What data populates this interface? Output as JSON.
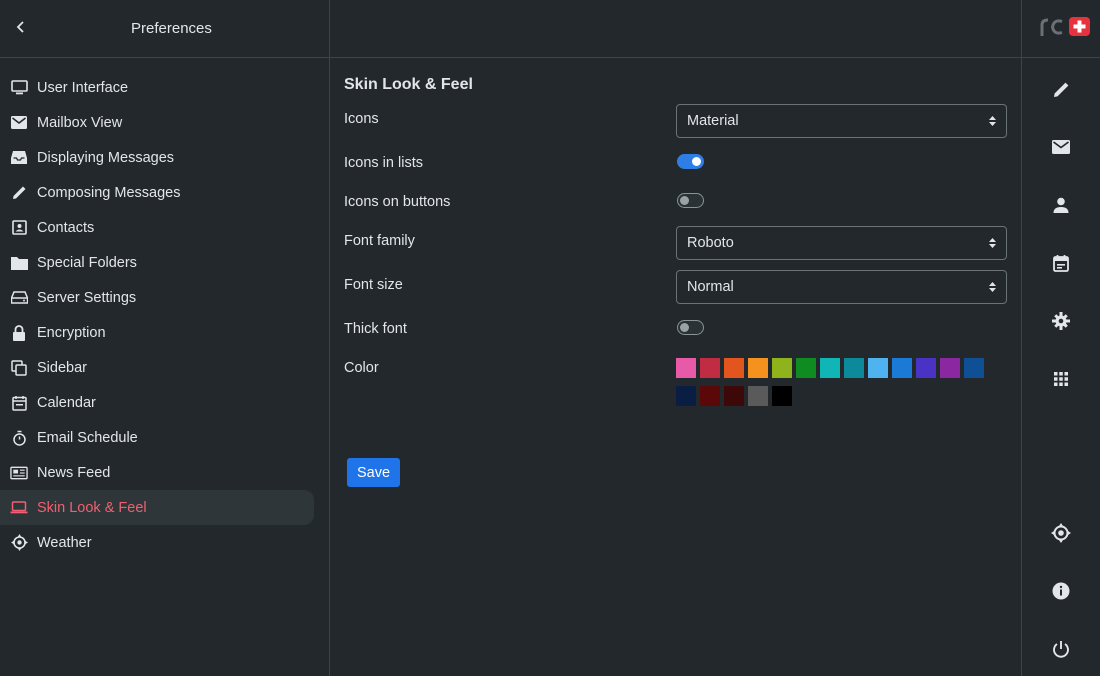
{
  "header": {
    "title": "Preferences"
  },
  "sidebar": {
    "items": [
      {
        "label": "User Interface",
        "icon": "monitor-icon"
      },
      {
        "label": "Mailbox View",
        "icon": "envelope-icon"
      },
      {
        "label": "Displaying Messages",
        "icon": "inbox-icon"
      },
      {
        "label": "Composing Messages",
        "icon": "pencil-icon"
      },
      {
        "label": "Contacts",
        "icon": "contact-card-icon"
      },
      {
        "label": "Special Folders",
        "icon": "folder-icon"
      },
      {
        "label": "Server Settings",
        "icon": "server-icon"
      },
      {
        "label": "Encryption",
        "icon": "lock-icon"
      },
      {
        "label": "Sidebar",
        "icon": "copy-icon"
      },
      {
        "label": "Calendar",
        "icon": "calendar-icon"
      },
      {
        "label": "Email Schedule",
        "icon": "stopwatch-icon"
      },
      {
        "label": "News Feed",
        "icon": "newspaper-icon"
      },
      {
        "label": "Skin Look & Feel",
        "icon": "laptop-icon",
        "active": true
      },
      {
        "label": "Weather",
        "icon": "sun-icon"
      }
    ]
  },
  "main": {
    "section_title": "Skin Look & Feel",
    "icons": {
      "label": "Icons",
      "value": "Material"
    },
    "icons_in_lists": {
      "label": "Icons in lists",
      "on": true
    },
    "icons_on_buttons": {
      "label": "Icons on buttons",
      "on": false
    },
    "font_family": {
      "label": "Font family",
      "value": "Roboto"
    },
    "font_size": {
      "label": "Font size",
      "value": "Normal"
    },
    "thick_font": {
      "label": "Thick font",
      "on": false
    },
    "color": {
      "label": "Color",
      "swatches": [
        "#e85aa8",
        "#c22c42",
        "#e2551e",
        "#f5921e",
        "#8fb31a",
        "#0e8c22",
        "#10b6b6",
        "#0d8a9a",
        "#4fb3f0",
        "#1a7ad6",
        "#4a33c4",
        "#8b27a0",
        "#0e4f96",
        "#0a1e44",
        "#5a0808",
        "#3c0808",
        "#5a5a5a",
        "#000000"
      ]
    },
    "save_label": "Save"
  },
  "rightbar": {
    "items": [
      "pencil-icon",
      "envelope-icon",
      "person-icon",
      "calendar-icon",
      "gear-icon",
      "grid-icon"
    ],
    "bottom": [
      "sun-icon",
      "info-icon",
      "power-icon"
    ]
  },
  "colors": {
    "accent": "#1f74e9",
    "active_text": "#f06070",
    "logo_red": "#e5323e"
  }
}
